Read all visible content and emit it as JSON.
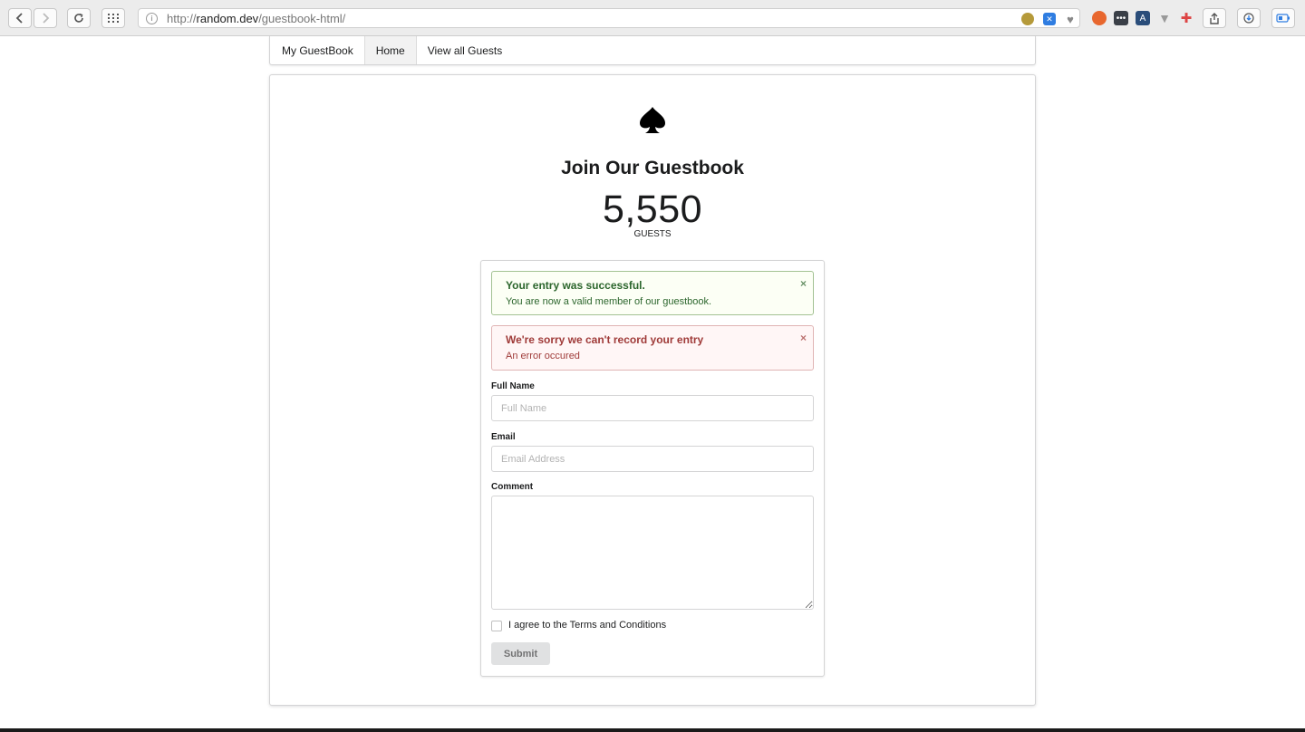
{
  "browser": {
    "url_prefix": "http://",
    "url_host": "random.dev",
    "url_path": "/guestbook-html/"
  },
  "menu": {
    "brand": "My GuestBook",
    "home": "Home",
    "view_all": "View all Guests"
  },
  "hero": {
    "title": "Join Our Guestbook",
    "count": "5,550",
    "count_label": "GUESTS",
    "logo_icon": "spade-icon"
  },
  "messages": {
    "success_header": "Your entry was successful.",
    "success_body": "You are now a valid member of our guestbook.",
    "error_header": "We're sorry we can't record your entry",
    "error_body": "An error occured",
    "close_glyph": "×"
  },
  "form": {
    "full_name_label": "Full Name",
    "full_name_placeholder": "Full Name",
    "full_name_value": "",
    "email_label": "Email",
    "email_placeholder": "Email Address",
    "email_value": "",
    "comment_label": "Comment",
    "comment_value": "",
    "terms_label": "I agree to the Terms and Conditions",
    "terms_checked": false,
    "submit_label": "Submit"
  },
  "colors": {
    "success_bg": "#fcfff5",
    "success_text": "#2c662d",
    "error_bg": "#fff6f6",
    "error_text": "#9f3a38"
  }
}
